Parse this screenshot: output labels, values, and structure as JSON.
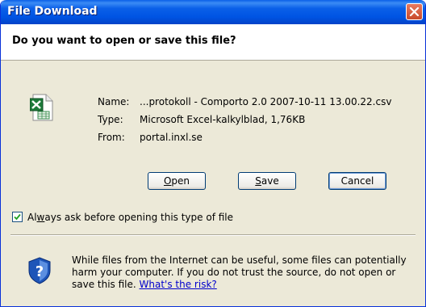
{
  "window": {
    "title": "File Download"
  },
  "dialog": {
    "question": "Do you want to open or save this file?",
    "file": {
      "icon": "excel-csv-file-icon",
      "name_label": "Name:",
      "name_value": "...protokoll - Comporto 2.0 2007-10-11 13.00.22.csv",
      "type_label": "Type:",
      "type_value": "Microsoft Excel-kalkylblad, 1,76KB",
      "from_label": "From:",
      "from_value": "portal.inxl.se"
    },
    "buttons": {
      "open": {
        "prefix": "",
        "accel": "O",
        "rest": "pen"
      },
      "save": {
        "prefix": "",
        "accel": "S",
        "rest": "ave"
      },
      "cancel": "Cancel"
    },
    "checkbox": {
      "checked": true,
      "label_prefix": "Al",
      "label_accel": "w",
      "label_rest": "ays ask before opening this type of file"
    },
    "warning": {
      "text": "While files from the Internet can be useful, some files can potentially harm your computer. If you do not trust the source, do not open or save this file. ",
      "link": "What's the risk?"
    }
  },
  "colors": {
    "title_bar": "#0054e3",
    "dialog_bg": "#ece9d8",
    "close_button": "#d7542f",
    "link": "#0000cc"
  }
}
